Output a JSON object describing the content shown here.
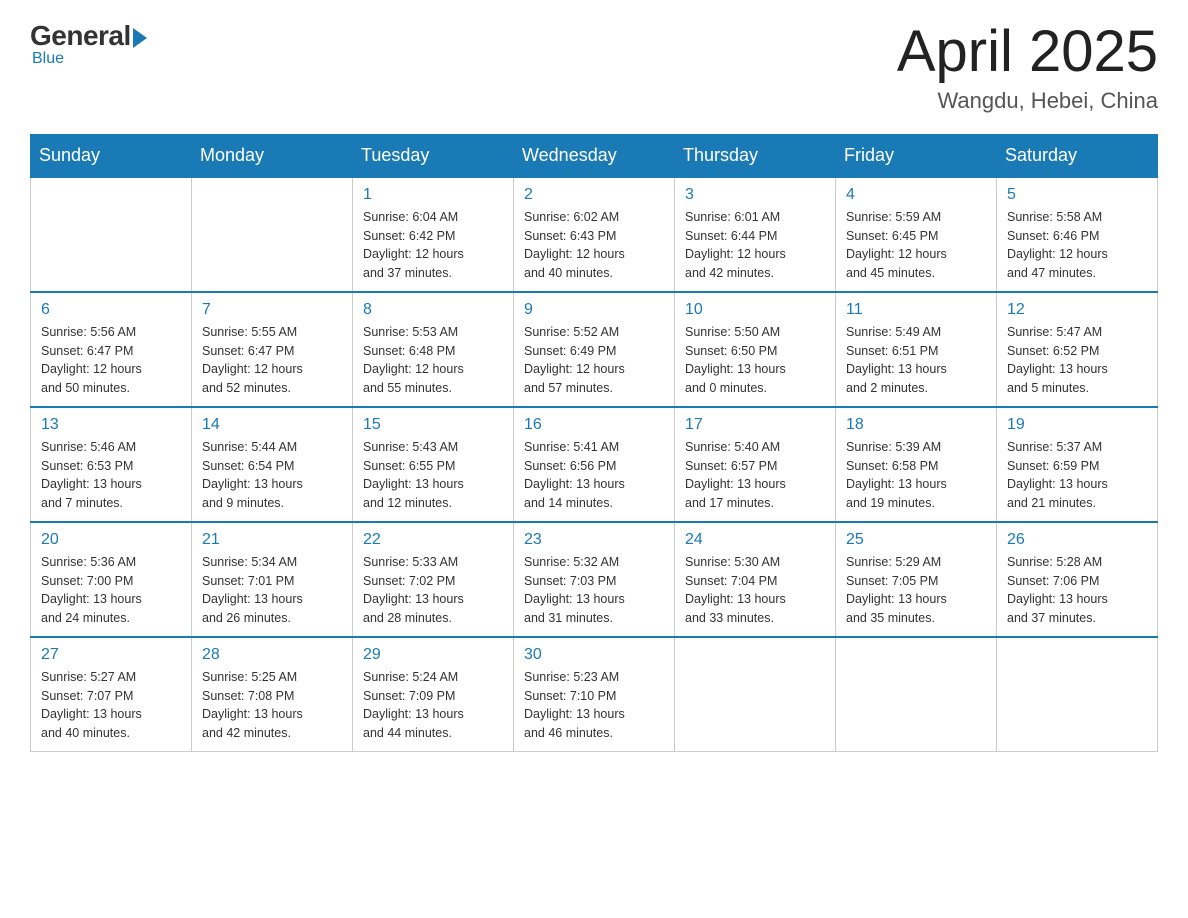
{
  "logo": {
    "general": "General",
    "blue": "Blue",
    "subtitle": "Blue"
  },
  "title": {
    "month": "April 2025",
    "location": "Wangdu, Hebei, China"
  },
  "weekdays": [
    "Sunday",
    "Monday",
    "Tuesday",
    "Wednesday",
    "Thursday",
    "Friday",
    "Saturday"
  ],
  "weeks": [
    [
      {
        "day": "",
        "info": ""
      },
      {
        "day": "",
        "info": ""
      },
      {
        "day": "1",
        "info": "Sunrise: 6:04 AM\nSunset: 6:42 PM\nDaylight: 12 hours\nand 37 minutes."
      },
      {
        "day": "2",
        "info": "Sunrise: 6:02 AM\nSunset: 6:43 PM\nDaylight: 12 hours\nand 40 minutes."
      },
      {
        "day": "3",
        "info": "Sunrise: 6:01 AM\nSunset: 6:44 PM\nDaylight: 12 hours\nand 42 minutes."
      },
      {
        "day": "4",
        "info": "Sunrise: 5:59 AM\nSunset: 6:45 PM\nDaylight: 12 hours\nand 45 minutes."
      },
      {
        "day": "5",
        "info": "Sunrise: 5:58 AM\nSunset: 6:46 PM\nDaylight: 12 hours\nand 47 minutes."
      }
    ],
    [
      {
        "day": "6",
        "info": "Sunrise: 5:56 AM\nSunset: 6:47 PM\nDaylight: 12 hours\nand 50 minutes."
      },
      {
        "day": "7",
        "info": "Sunrise: 5:55 AM\nSunset: 6:47 PM\nDaylight: 12 hours\nand 52 minutes."
      },
      {
        "day": "8",
        "info": "Sunrise: 5:53 AM\nSunset: 6:48 PM\nDaylight: 12 hours\nand 55 minutes."
      },
      {
        "day": "9",
        "info": "Sunrise: 5:52 AM\nSunset: 6:49 PM\nDaylight: 12 hours\nand 57 minutes."
      },
      {
        "day": "10",
        "info": "Sunrise: 5:50 AM\nSunset: 6:50 PM\nDaylight: 13 hours\nand 0 minutes."
      },
      {
        "day": "11",
        "info": "Sunrise: 5:49 AM\nSunset: 6:51 PM\nDaylight: 13 hours\nand 2 minutes."
      },
      {
        "day": "12",
        "info": "Sunrise: 5:47 AM\nSunset: 6:52 PM\nDaylight: 13 hours\nand 5 minutes."
      }
    ],
    [
      {
        "day": "13",
        "info": "Sunrise: 5:46 AM\nSunset: 6:53 PM\nDaylight: 13 hours\nand 7 minutes."
      },
      {
        "day": "14",
        "info": "Sunrise: 5:44 AM\nSunset: 6:54 PM\nDaylight: 13 hours\nand 9 minutes."
      },
      {
        "day": "15",
        "info": "Sunrise: 5:43 AM\nSunset: 6:55 PM\nDaylight: 13 hours\nand 12 minutes."
      },
      {
        "day": "16",
        "info": "Sunrise: 5:41 AM\nSunset: 6:56 PM\nDaylight: 13 hours\nand 14 minutes."
      },
      {
        "day": "17",
        "info": "Sunrise: 5:40 AM\nSunset: 6:57 PM\nDaylight: 13 hours\nand 17 minutes."
      },
      {
        "day": "18",
        "info": "Sunrise: 5:39 AM\nSunset: 6:58 PM\nDaylight: 13 hours\nand 19 minutes."
      },
      {
        "day": "19",
        "info": "Sunrise: 5:37 AM\nSunset: 6:59 PM\nDaylight: 13 hours\nand 21 minutes."
      }
    ],
    [
      {
        "day": "20",
        "info": "Sunrise: 5:36 AM\nSunset: 7:00 PM\nDaylight: 13 hours\nand 24 minutes."
      },
      {
        "day": "21",
        "info": "Sunrise: 5:34 AM\nSunset: 7:01 PM\nDaylight: 13 hours\nand 26 minutes."
      },
      {
        "day": "22",
        "info": "Sunrise: 5:33 AM\nSunset: 7:02 PM\nDaylight: 13 hours\nand 28 minutes."
      },
      {
        "day": "23",
        "info": "Sunrise: 5:32 AM\nSunset: 7:03 PM\nDaylight: 13 hours\nand 31 minutes."
      },
      {
        "day": "24",
        "info": "Sunrise: 5:30 AM\nSunset: 7:04 PM\nDaylight: 13 hours\nand 33 minutes."
      },
      {
        "day": "25",
        "info": "Sunrise: 5:29 AM\nSunset: 7:05 PM\nDaylight: 13 hours\nand 35 minutes."
      },
      {
        "day": "26",
        "info": "Sunrise: 5:28 AM\nSunset: 7:06 PM\nDaylight: 13 hours\nand 37 minutes."
      }
    ],
    [
      {
        "day": "27",
        "info": "Sunrise: 5:27 AM\nSunset: 7:07 PM\nDaylight: 13 hours\nand 40 minutes."
      },
      {
        "day": "28",
        "info": "Sunrise: 5:25 AM\nSunset: 7:08 PM\nDaylight: 13 hours\nand 42 minutes."
      },
      {
        "day": "29",
        "info": "Sunrise: 5:24 AM\nSunset: 7:09 PM\nDaylight: 13 hours\nand 44 minutes."
      },
      {
        "day": "30",
        "info": "Sunrise: 5:23 AM\nSunset: 7:10 PM\nDaylight: 13 hours\nand 46 minutes."
      },
      {
        "day": "",
        "info": ""
      },
      {
        "day": "",
        "info": ""
      },
      {
        "day": "",
        "info": ""
      }
    ]
  ]
}
